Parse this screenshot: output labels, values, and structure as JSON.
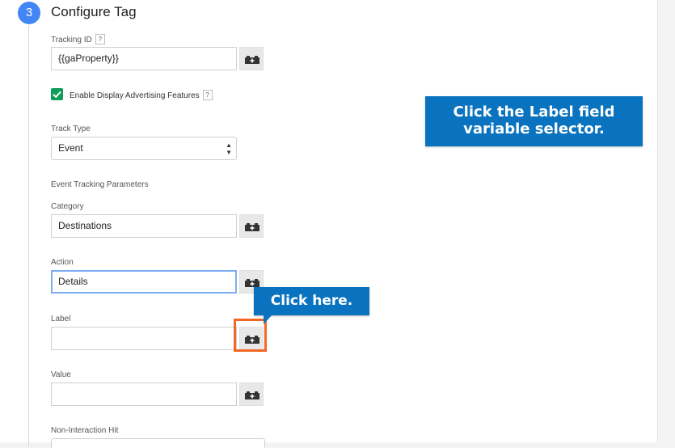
{
  "step": {
    "number": "3",
    "title": "Configure Tag"
  },
  "tracking_id": {
    "label": "Tracking ID",
    "help": "?",
    "value": "{{gaProperty}}"
  },
  "display_advertising": {
    "checked": true,
    "label": "Enable Display Advertising Features",
    "help": "?"
  },
  "track_type": {
    "label": "Track Type",
    "selected": "Event"
  },
  "event_params": {
    "heading": "Event Tracking Parameters",
    "category": {
      "label": "Category",
      "value": "Destinations"
    },
    "action": {
      "label": "Action",
      "value": "Details"
    },
    "label": {
      "label": "Label",
      "value": ""
    },
    "value": {
      "label": "Value",
      "value": ""
    }
  },
  "non_interaction": {
    "label": "Non-Interaction Hit"
  },
  "callouts": {
    "main": "Click the Label field variable selector.",
    "small": "Click here."
  },
  "colors": {
    "step_badge": "#4285f4",
    "checkbox": "#0f9d58",
    "callout": "#0a73bf",
    "highlight": "#f26722",
    "focus_border": "#7eaef1"
  },
  "icons": {
    "variable_button": "lego-brick-plus-icon",
    "checkbox": "checkmark-icon",
    "select": "up-down-arrows-icon"
  }
}
